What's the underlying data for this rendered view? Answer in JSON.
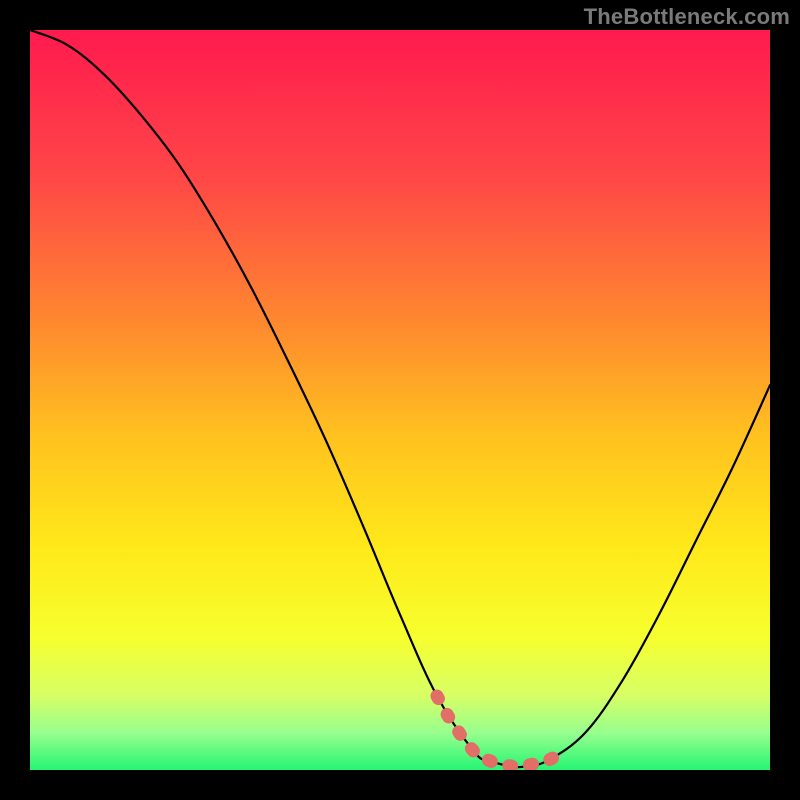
{
  "watermark": "TheBottleneck.com",
  "chart_data": {
    "type": "line",
    "title": "",
    "xlabel": "",
    "ylabel": "",
    "xlim": [
      0,
      100
    ],
    "ylim": [
      0,
      100
    ],
    "curve": {
      "x": [
        0,
        5,
        10,
        15,
        20,
        25,
        30,
        35,
        40,
        45,
        50,
        55,
        60,
        62,
        65,
        67,
        70,
        75,
        80,
        85,
        90,
        95,
        100
      ],
      "y": [
        100,
        98,
        94,
        88.5,
        82,
        74,
        65,
        55,
        44.5,
        33,
        21,
        10,
        2.5,
        1.3,
        0.5,
        0.5,
        1.3,
        5,
        12,
        21,
        31,
        41,
        52
      ]
    },
    "highlight": {
      "x": [
        55,
        57,
        60,
        62,
        64,
        66,
        68,
        70,
        71.5
      ],
      "y": [
        10,
        6.5,
        2.5,
        1.3,
        0.7,
        0.5,
        0.8,
        1.3,
        2.2
      ]
    },
    "gradient_stops": [
      {
        "offset": 0.0,
        "color": "#ff1a4e"
      },
      {
        "offset": 0.2,
        "color": "#ff4747"
      },
      {
        "offset": 0.4,
        "color": "#ff8a2e"
      },
      {
        "offset": 0.55,
        "color": "#ffc21f"
      },
      {
        "offset": 0.7,
        "color": "#ffe91a"
      },
      {
        "offset": 0.82,
        "color": "#f7ff2e"
      },
      {
        "offset": 0.9,
        "color": "#d6ff66"
      },
      {
        "offset": 0.95,
        "color": "#97ff8e"
      },
      {
        "offset": 1.0,
        "color": "#25f573"
      }
    ],
    "highlight_color": "#e26e68"
  }
}
